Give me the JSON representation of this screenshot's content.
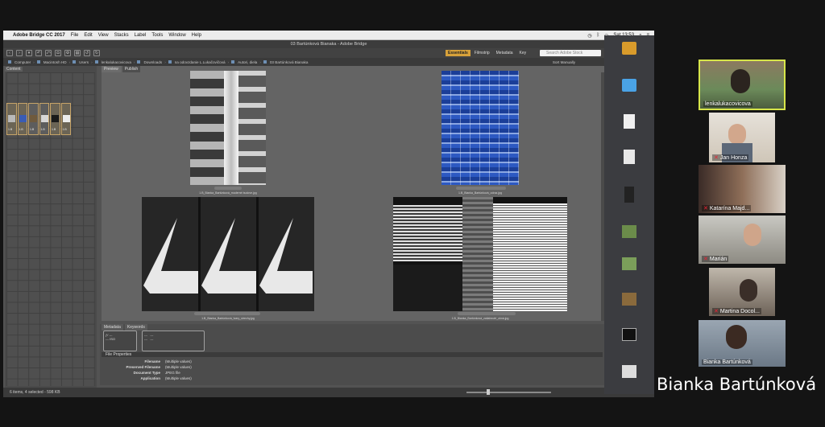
{
  "menubar": {
    "app_name": "Adobe Bridge CC 2017",
    "items": [
      "File",
      "Edit",
      "View",
      "Stacks",
      "Label",
      "Tools",
      "Window",
      "Help"
    ],
    "clock": "Sat 13:53"
  },
  "window_title": "03 Bartúnková Bianaka - Adobe Bridge",
  "workspaces": [
    "Essentials",
    "Filmstrip",
    "Metadata",
    "Key"
  ],
  "stock_search_placeholder": "Search Adobe Stock",
  "breadcrumbs": [
    "Computer",
    "Macintosh HD",
    "Users",
    "lenkalukacovicova",
    "Downloads",
    "na odovzdanie L.Lukačovičová",
    "Autori, diela",
    "03 Bartúnková Bianaka"
  ],
  "sort_label": "Sort Manually",
  "left_panel_tab": "Content",
  "content_thumbs": [
    "1.B",
    "1.B",
    "1.B",
    "1.B",
    "1.B",
    "1.B"
  ],
  "preview_tabs": [
    "Preview",
    "Publish"
  ],
  "images": [
    {
      "caption": "1.B_Bianka_Bartúnková_moderné budove.jpg",
      "colors": [
        "#d9d9d9",
        "#6b6b6b"
      ]
    },
    {
      "caption": "1.B_Bianka_Bartúnková_odraz.jpg",
      "colors": [
        "#2c53b8",
        "#9fb6e6"
      ]
    },
    {
      "caption": "1.B_Bianka_Bartúnková_tvary_strechy.jpg",
      "colors": [
        "#1e1e1e",
        "#e8e8e8"
      ]
    },
    {
      "caption": "1.B_Bianka_Bartúnková_zatiahnuté_okná.jpg",
      "colors": [
        "#141414",
        "#f1f1f1"
      ]
    }
  ],
  "bottom_tabs": [
    "Metadata",
    "Keywords"
  ],
  "file_properties": {
    "title": "File Properties",
    "rows": [
      {
        "key": "Filename",
        "value": "(Multiple values)"
      },
      {
        "key": "Preserved Filename",
        "value": "(Multiple values)"
      },
      {
        "key": "Document Type",
        "value": "JPEG file"
      },
      {
        "key": "Application",
        "value": "(Multiple values)"
      }
    ]
  },
  "status": "6 items, 4 selected - 598 KB",
  "participants": [
    {
      "name": "lenkalukacovicova",
      "muted": false,
      "active": true
    },
    {
      "name": "Jan Honza",
      "muted": true,
      "active": false
    },
    {
      "name": "Katarína Majd...",
      "muted": true,
      "active": false
    },
    {
      "name": "Marián",
      "muted": true,
      "active": false
    },
    {
      "name": "Martina Docol...",
      "muted": true,
      "active": false
    },
    {
      "name": "Bianka Bartúnková",
      "muted": false,
      "active": false
    }
  ],
  "speaker": "Bianka Bartúnková"
}
